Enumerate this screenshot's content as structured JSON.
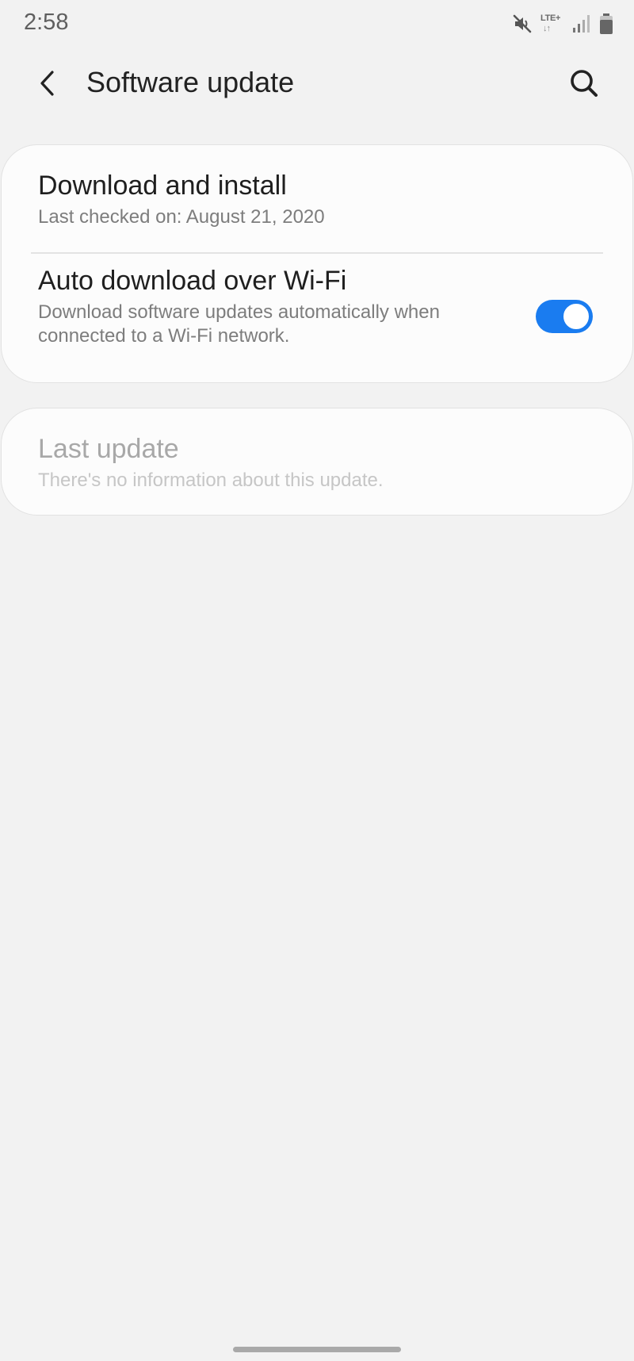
{
  "status_bar": {
    "time": "2:58",
    "network_label": "LTE+",
    "data_arrows": "↓↑",
    "icons": [
      "mute-icon",
      "lte-icon",
      "signal-icon",
      "battery-icon"
    ]
  },
  "app_bar": {
    "title": "Software update",
    "back_icon": "back-arrow-icon",
    "search_icon": "search-icon"
  },
  "settings": {
    "download_install": {
      "title": "Download and install",
      "subtitle": "Last checked on: August 21, 2020"
    },
    "auto_download": {
      "title": "Auto download over Wi-Fi",
      "subtitle": "Download software updates automatically when connected to a Wi-Fi network.",
      "toggle_on": true
    },
    "last_update": {
      "title": "Last update",
      "subtitle": "There's no information about this update.",
      "enabled": false
    }
  },
  "colors": {
    "accent": "#1a7cf0",
    "background": "#f2f2f2",
    "card": "#fcfcfc"
  }
}
